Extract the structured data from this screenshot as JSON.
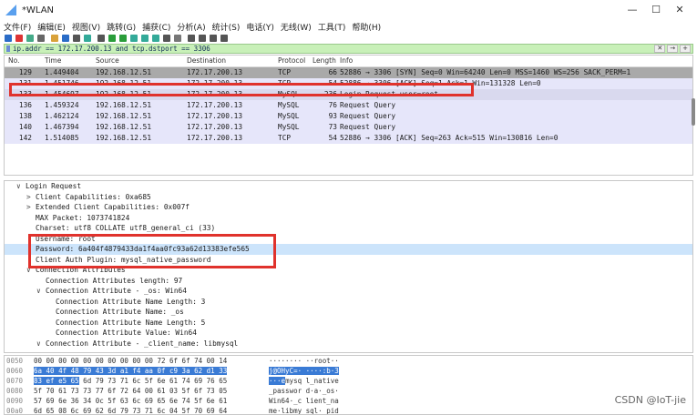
{
  "window": {
    "title": "*WLAN",
    "min": "—",
    "max": "☐",
    "close": "✕"
  },
  "menu": [
    "文件(F)",
    "编辑(E)",
    "视图(V)",
    "跳转(G)",
    "捕获(C)",
    "分析(A)",
    "统计(S)",
    "电话(Y)",
    "无线(W)",
    "工具(T)",
    "帮助(H)"
  ],
  "toolbar_icons": [
    "fin-icon",
    "stop-icon",
    "restart-icon",
    "options-icon",
    "open-icon",
    "save-icon",
    "close-file-icon",
    "reload-icon",
    "find-icon",
    "back-icon",
    "forward-icon",
    "goto-icon",
    "first-icon",
    "last-icon",
    "autoscroll-icon",
    "colorize-icon",
    "zoom-in-icon",
    "zoom-out-icon",
    "zoom-reset-icon",
    "resize-columns-icon"
  ],
  "filter": {
    "text": "ip.addr == 172.17.200.13 and tcp.dstport == 3306",
    "btn_clear": "✕",
    "btn_apply": "→",
    "btn_add": "+"
  },
  "packet_list": {
    "headers": {
      "no": "No.",
      "time": "Time",
      "source": "Source",
      "destination": "Destination",
      "protocol": "Protocol",
      "length": "Length",
      "info": "Info"
    },
    "rows": [
      {
        "no": "129",
        "time": "1.449404",
        "source": "192.168.12.51",
        "destination": "172.17.200.13",
        "protocol": "TCP",
        "length": "66",
        "info": "52886 → 3306 [SYN] Seq=0 Win=64240 Len=0 MSS=1460 WS=256 SACK_PERM=1",
        "style": "tcp-sel"
      },
      {
        "no": "131",
        "time": "1.451746",
        "source": "192.168.12.51",
        "destination": "172.17.200.13",
        "protocol": "TCP",
        "length": "54",
        "info": "52886 → 3306 [ACK] Seq=1 Ack=1 Win=131328 Len=0",
        "style": "tcp"
      },
      {
        "no": "133",
        "time": "1.454697",
        "source": "192.168.12.51",
        "destination": "172.17.200.13",
        "protocol": "MySQL",
        "length": "236",
        "info": "Login Request user=root",
        "style": "selected"
      },
      {
        "no": "136",
        "time": "1.459324",
        "source": "192.168.12.51",
        "destination": "172.17.200.13",
        "protocol": "MySQL",
        "length": "76",
        "info": "Request Query",
        "style": "mysql"
      },
      {
        "no": "138",
        "time": "1.462124",
        "source": "192.168.12.51",
        "destination": "172.17.200.13",
        "protocol": "MySQL",
        "length": "93",
        "info": "Request Query",
        "style": "mysql"
      },
      {
        "no": "140",
        "time": "1.467394",
        "source": "192.168.12.51",
        "destination": "172.17.200.13",
        "protocol": "MySQL",
        "length": "73",
        "info": "Request Query",
        "style": "mysql"
      },
      {
        "no": "142",
        "time": "1.514085",
        "source": "192.168.12.51",
        "destination": "172.17.200.13",
        "protocol": "TCP",
        "length": "54",
        "info": "52886 → 3306 [ACK] Seq=263 Ack=515 Win=130816 Len=0",
        "style": "tcp"
      }
    ]
  },
  "details": [
    {
      "indent": 1,
      "caret": "∨",
      "text": "Login Request"
    },
    {
      "indent": 2,
      "caret": ">",
      "text": "Client Capabilities: 0xa685"
    },
    {
      "indent": 2,
      "caret": ">",
      "text": "Extended Client Capabilities: 0x007f"
    },
    {
      "indent": 2,
      "caret": "",
      "text": "MAX Packet: 1073741824"
    },
    {
      "indent": 2,
      "caret": "",
      "text": "Charset: utf8 COLLATE utf8_general_ci (33)"
    },
    {
      "indent": 2,
      "caret": "",
      "text": "Username: root"
    },
    {
      "indent": 2,
      "caret": "",
      "text": "Password: 6a404f4879433da1f4aa0fc93a62d13383efe565",
      "hl": true
    },
    {
      "indent": 2,
      "caret": "",
      "text": "Client Auth Plugin: mysql_native_password"
    },
    {
      "indent": 2,
      "caret": "∨",
      "text": "Connection Attributes"
    },
    {
      "indent": 3,
      "caret": "",
      "text": "Connection Attributes length: 97"
    },
    {
      "indent": 3,
      "caret": "∨",
      "text": "Connection Attribute - _os: Win64"
    },
    {
      "indent": 4,
      "caret": "",
      "text": "Connection Attribute Name Length: 3"
    },
    {
      "indent": 4,
      "caret": "",
      "text": "Connection Attribute Name: _os"
    },
    {
      "indent": 4,
      "caret": "",
      "text": "Connection Attribute Name Length: 5"
    },
    {
      "indent": 4,
      "caret": "",
      "text": "Connection Attribute Value: Win64"
    },
    {
      "indent": 3,
      "caret": "∨",
      "text": "Connection Attribute - _client_name: libmysql"
    }
  ],
  "bytes": [
    {
      "off": "0050",
      "hex_pre": "00 00 00 00 00 00 00 00  00 00 72 6f 6f 74 00 14",
      "hex_hl": "",
      "hex_post": "",
      "asc_pre": "········ ··root··",
      "asc_hl": "",
      "asc_post": ""
    },
    {
      "off": "0060",
      "hex_pre": "",
      "hex_hl": "6a 40 4f 48 79 43 3d a1  f4 aa 0f c9 3a 62 d1 33",
      "hex_post": "",
      "asc_pre": "",
      "asc_hl": "j@OHyC=· ····:b·3",
      "asc_post": ""
    },
    {
      "off": "0070",
      "hex_pre": "",
      "hex_hl": "83 ef e5 65",
      "hex_post": " 6d 79 73 71  6c 5f 6e 61 74 69 76 65",
      "asc_pre": "",
      "asc_hl": "···e",
      "asc_post": "mysq l_native"
    },
    {
      "off": "0080",
      "hex_pre": "5f 70 61 73 73 77 6f 72  64 00 61 03 5f 6f 73 05",
      "hex_hl": "",
      "hex_post": "",
      "asc_pre": "_passwor d·a·_os·",
      "asc_hl": "",
      "asc_post": ""
    },
    {
      "off": "0090",
      "hex_pre": "57 69 6e 36 34 0c 5f 63  6c 69 65 6e 74 5f 6e 61",
      "hex_hl": "",
      "hex_post": "",
      "asc_pre": "Win64·_c lient_na",
      "asc_hl": "",
      "asc_post": ""
    },
    {
      "off": "00a0",
      "hex_pre": "6d 65 08 6c 69 62 6d 79  73 71 6c 04 5f 70 69 64",
      "hex_hl": "",
      "hex_post": "",
      "asc_pre": "me·libmy sql·_pid",
      "asc_hl": "",
      "asc_post": ""
    }
  ],
  "watermark": "CSDN @IoT-jie",
  "colors": {
    "filter_ok": "#c8f0b8",
    "selected_row": "#a9a9a9",
    "row_bg": "#e6e6fa",
    "highlight": "#cce4fb",
    "annotation": "#e0322c"
  }
}
